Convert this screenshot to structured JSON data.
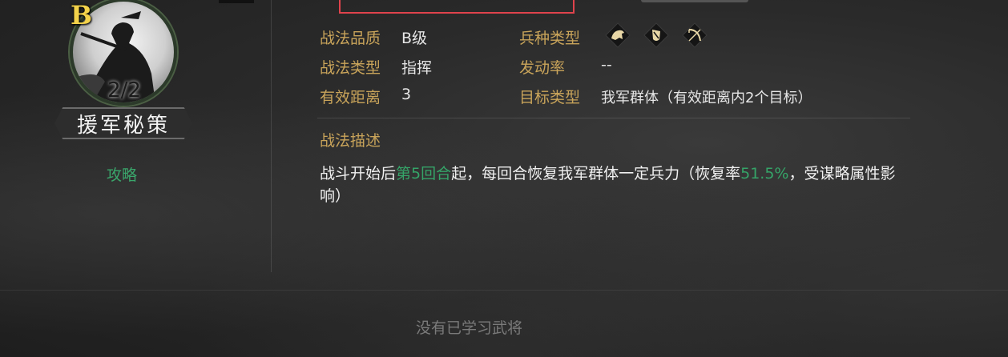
{
  "skill": {
    "grade_badge": "B",
    "level_count": "2/2",
    "name": "援军秘策",
    "strategy_link": "攻略"
  },
  "attributes": {
    "quality_label": "战法品质",
    "quality_value": "B级",
    "type_label": "战法类型",
    "type_value": "指挥",
    "range_label": "有效距离",
    "range_value": "3",
    "troop_label": "兵种类型",
    "troop_icons": [
      "cavalry-icon",
      "shield-icon",
      "bow-icon"
    ],
    "rate_label": "发动率",
    "rate_value": "--",
    "target_label": "目标类型",
    "target_value": "我军群体（有效距离内2个目标）"
  },
  "description": {
    "title": "战法描述",
    "part1": "战斗开始后",
    "highlight1": "第5回合",
    "part2": "起，每回合恢复我军群体一定兵力（恢复率",
    "highlight2": "51.5%",
    "part3": "，受谋略属性影响）"
  },
  "footer": {
    "no_learned": "没有已学习武将"
  },
  "colors": {
    "label_gold": "#c9a45a",
    "highlight_green": "#35a468",
    "grade_yellow": "#f3d24a",
    "selection_red": "#e0434c"
  }
}
